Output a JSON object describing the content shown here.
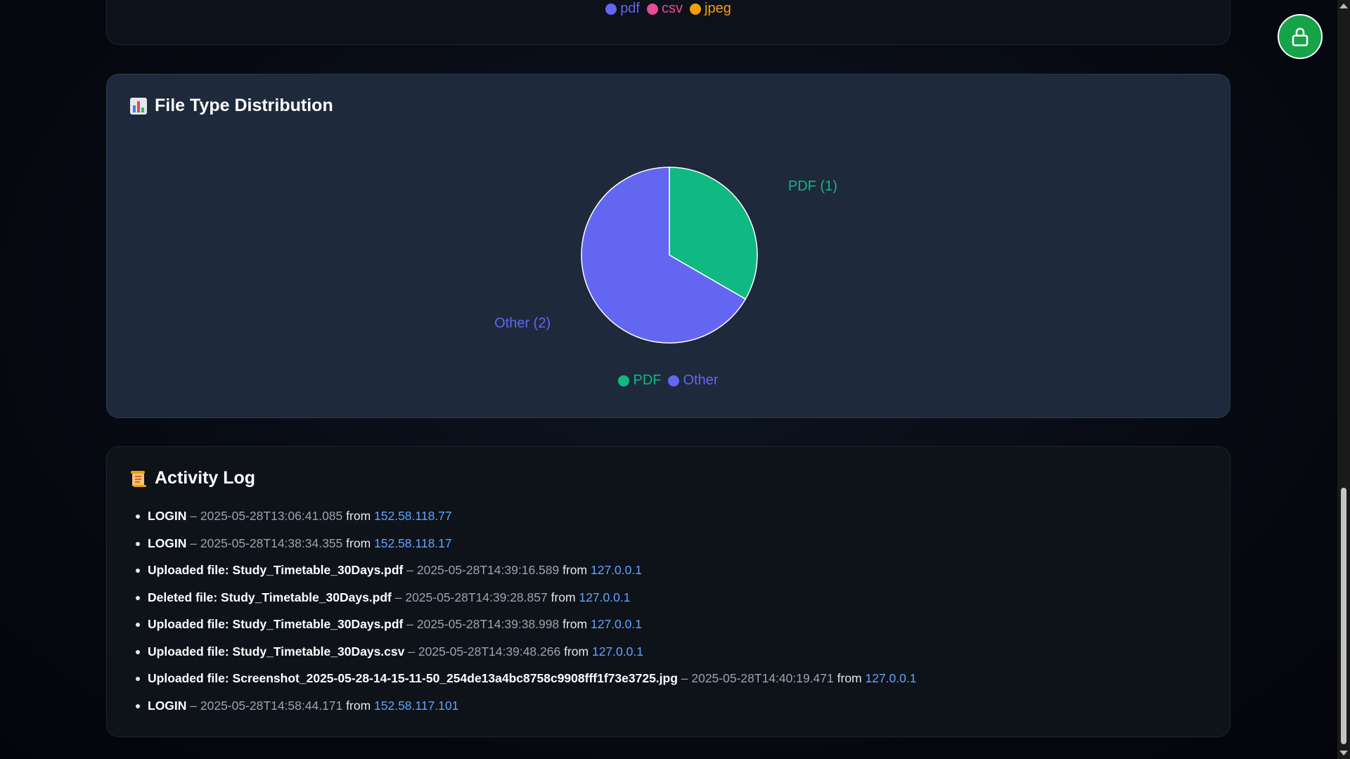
{
  "top_legend": [
    {
      "label": "pdf",
      "color": "#6366f1"
    },
    {
      "label": "csv",
      "color": "#ec4899"
    },
    {
      "label": "jpeg",
      "color": "#f59e0b"
    }
  ],
  "distribution": {
    "title": "File Type Distribution",
    "icon": "bar-chart-icon"
  },
  "chart_data": {
    "type": "pie",
    "categories": [
      "PDF",
      "Other"
    ],
    "values": [
      1,
      2
    ],
    "colors": [
      "#10b981",
      "#6366f1"
    ],
    "slice_labels": [
      "PDF (1)",
      "Other (2)"
    ],
    "legend": [
      "PDF",
      "Other"
    ],
    "legend_position": "bottom"
  },
  "activity_log": {
    "title": "Activity Log",
    "icon": "scroll-icon",
    "entries": [
      {
        "action": "LOGIN",
        "timestamp": "2025-05-28T13:06:41.085",
        "from": "from",
        "ip": "152.58.118.77"
      },
      {
        "action": "LOGIN",
        "timestamp": "2025-05-28T14:38:34.355",
        "from": "from",
        "ip": "152.58.118.17"
      },
      {
        "action": "Uploaded file: Study_Timetable_30Days.pdf",
        "timestamp": "2025-05-28T14:39:16.589",
        "from": "from",
        "ip": "127.0.0.1"
      },
      {
        "action": "Deleted file: Study_Timetable_30Days.pdf",
        "timestamp": "2025-05-28T14:39:28.857",
        "from": "from",
        "ip": "127.0.0.1"
      },
      {
        "action": "Uploaded file: Study_Timetable_30Days.pdf",
        "timestamp": "2025-05-28T14:39:38.998",
        "from": "from",
        "ip": "127.0.0.1"
      },
      {
        "action": "Uploaded file: Study_Timetable_30Days.csv",
        "timestamp": "2025-05-28T14:39:48.266",
        "from": "from",
        "ip": "127.0.0.1"
      },
      {
        "action": "Uploaded file: Screenshot_2025-05-28-14-15-11-50_254de13a4bc8758c9908fff1f73e3725.jpg",
        "timestamp": "2025-05-28T14:40:19.471",
        "from": "from",
        "ip": "127.0.0.1"
      },
      {
        "action": "LOGIN",
        "timestamp": "2025-05-28T14:58:44.171",
        "from": "from",
        "ip": "152.58.117.101"
      }
    ]
  },
  "lock_button": {
    "icon": "lock-icon",
    "color": "#16a34a"
  }
}
